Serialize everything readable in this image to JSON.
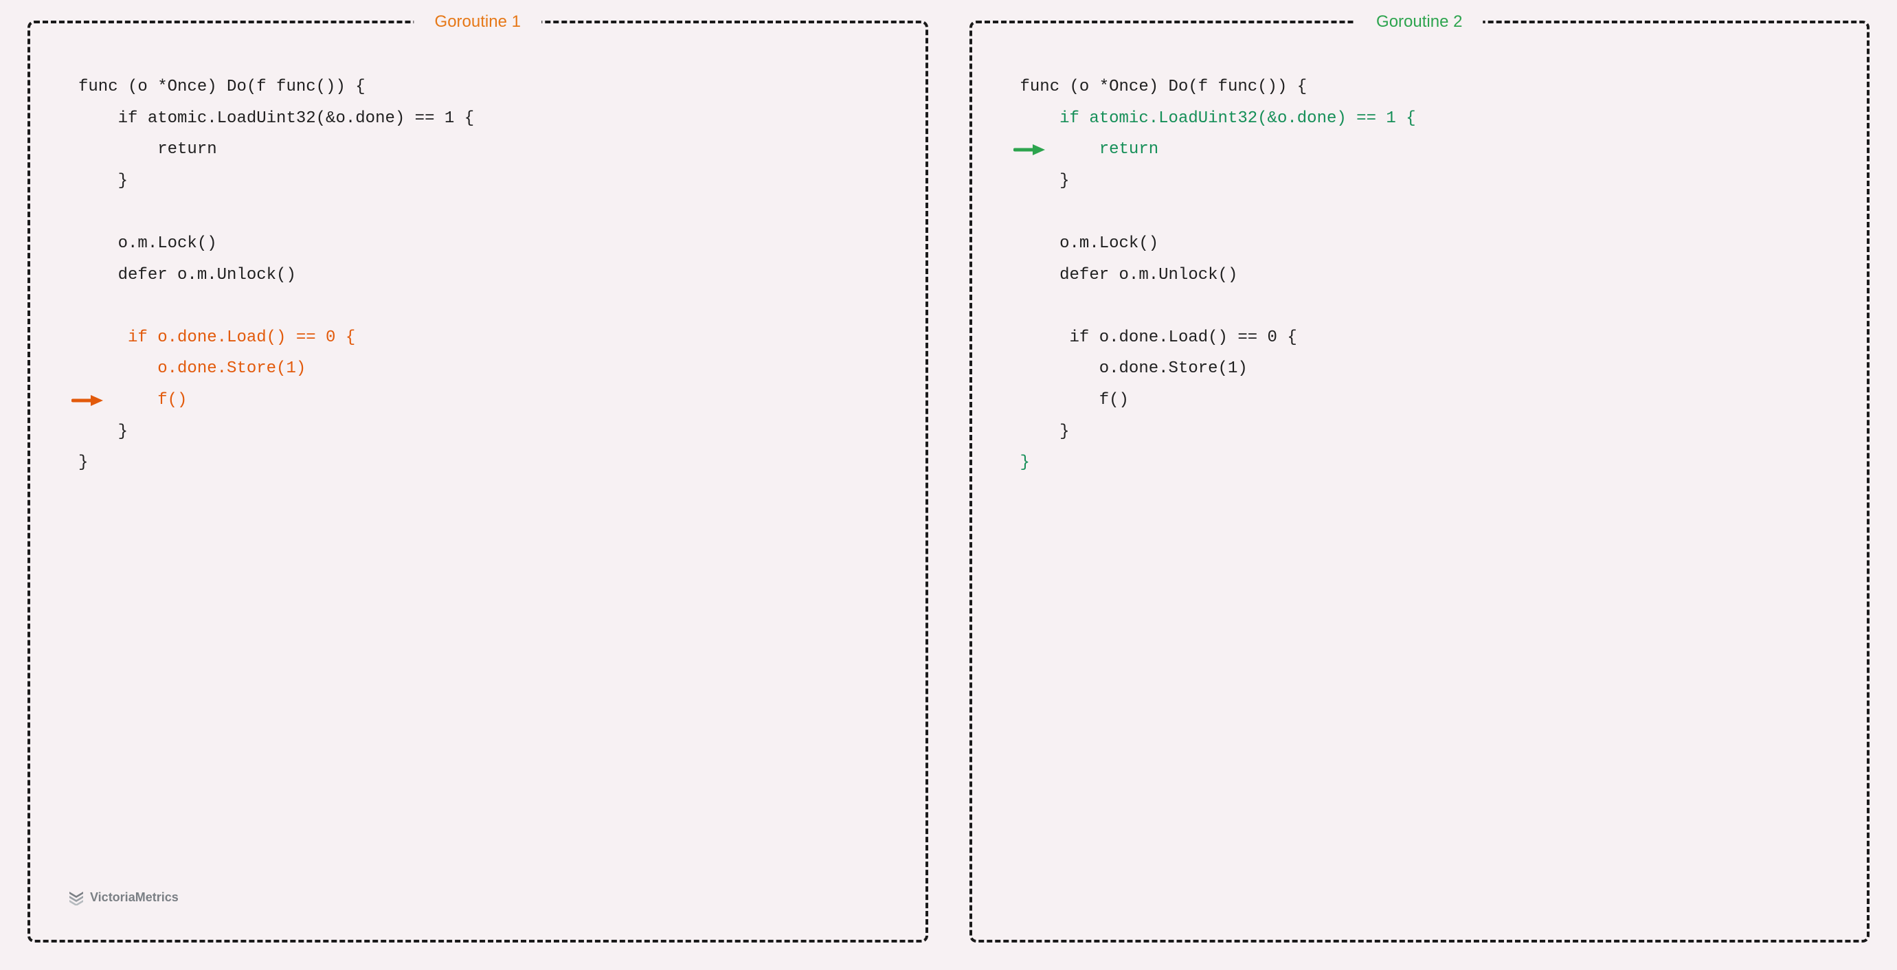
{
  "panel1": {
    "title": "Goroutine 1",
    "accent": "#e67817",
    "arrow_line_index": 8,
    "lines": [
      {
        "text": "func (o *Once) Do(f func()) {",
        "indent": 0,
        "hl": false
      },
      {
        "text": "if atomic.LoadUint32(&o.done) == 1 {",
        "indent": 1,
        "hl": false
      },
      {
        "text": "return",
        "indent": 2,
        "hl": false
      },
      {
        "text": "}",
        "indent": 1,
        "hl": false
      },
      {
        "text": "",
        "indent": 0,
        "hl": false,
        "blank": true
      },
      {
        "text": "o.m.Lock()",
        "indent": 1,
        "hl": false
      },
      {
        "text": "defer o.m.Unlock()",
        "indent": 1,
        "hl": false
      },
      {
        "text": "",
        "indent": 0,
        "hl": false,
        "blank": true
      },
      {
        "text": " if o.done.Load() == 0 {",
        "indent": 1,
        "hl": true
      },
      {
        "text": "o.done.Store(1)",
        "indent": 2,
        "hl": true
      },
      {
        "text": "f()",
        "indent": 2,
        "hl": true,
        "arrow": true
      },
      {
        "text": "}",
        "indent": 1,
        "hl": false
      },
      {
        "text": "}",
        "indent": 0,
        "hl": false
      }
    ]
  },
  "panel2": {
    "title": "Goroutine 2",
    "accent": "#2da44e",
    "arrow_line_index": 1,
    "lines": [
      {
        "text": "func (o *Once) Do(f func()) {",
        "indent": 0,
        "hl": false
      },
      {
        "text": "if atomic.LoadUint32(&o.done) == 1 {",
        "indent": 1,
        "hl": true
      },
      {
        "text": "return",
        "indent": 2,
        "hl": true,
        "arrow": true
      },
      {
        "text": "}",
        "indent": 1,
        "hl": false
      },
      {
        "text": "",
        "indent": 0,
        "hl": false,
        "blank": true
      },
      {
        "text": "o.m.Lock()",
        "indent": 1,
        "hl": false
      },
      {
        "text": "defer o.m.Unlock()",
        "indent": 1,
        "hl": false
      },
      {
        "text": "",
        "indent": 0,
        "hl": false,
        "blank": true
      },
      {
        "text": " if o.done.Load() == 0 {",
        "indent": 1,
        "hl": false
      },
      {
        "text": "o.done.Store(1)",
        "indent": 2,
        "hl": false
      },
      {
        "text": "f()",
        "indent": 2,
        "hl": false
      },
      {
        "text": "}",
        "indent": 1,
        "hl": false
      },
      {
        "text": "}",
        "indent": 0,
        "hl": true
      }
    ]
  },
  "attribution": "VictoriaMetrics",
  "hl_colors": {
    "panel1": "#e25a0b",
    "panel2": "#168f58"
  },
  "arrow_colors": {
    "panel1": "#e25a0b",
    "panel2": "#2da44e"
  }
}
